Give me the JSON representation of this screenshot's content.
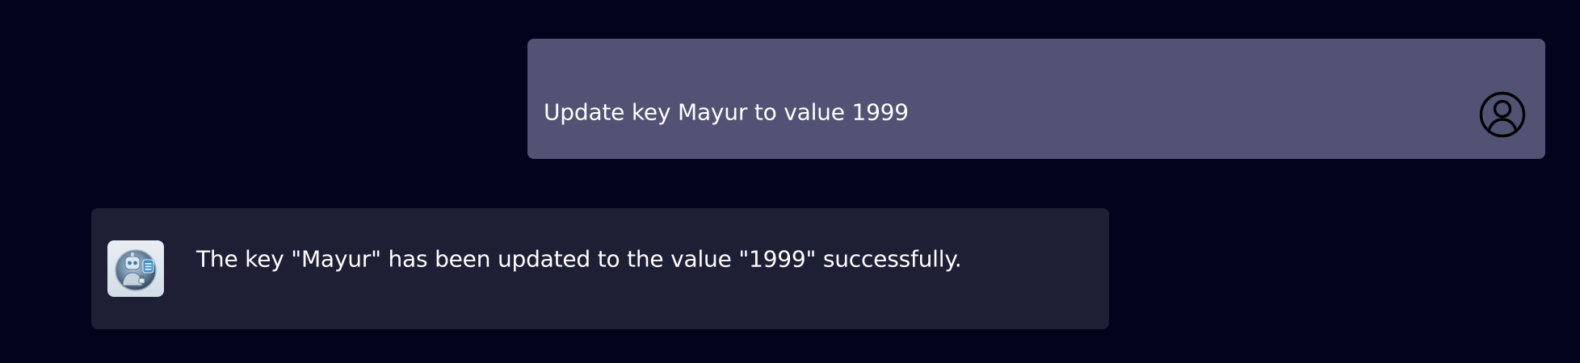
{
  "messages": [
    {
      "role": "user",
      "text": "Update key Mayur to value 1999",
      "avatar_icon": "user-circle-icon"
    },
    {
      "role": "assistant",
      "text": "The key \"Mayur\" has been updated to the value \"1999\" successfully.",
      "avatar_icon": "robot-avatar-icon"
    }
  ],
  "colors": {
    "page_background": "#03031c",
    "user_bubble": "#525274",
    "assistant_bubble": "#1e1e35",
    "text": "#ffffff"
  }
}
